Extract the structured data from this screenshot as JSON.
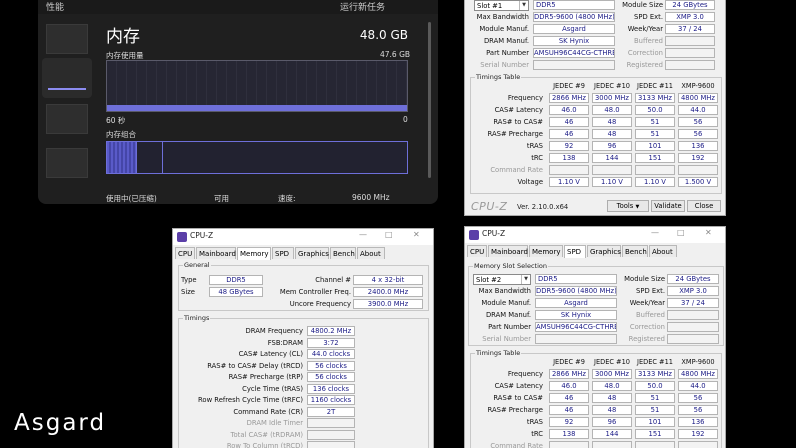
{
  "taskmgr": {
    "top_title": "性能",
    "top_right": "运行新任务",
    "title": "内存",
    "total": "48.0 GB",
    "usage_label": "内存使用量",
    "usage_max": "47.6 GB",
    "time_label": "60 秒",
    "zero_label": "0",
    "composition_label": "内存组合",
    "in_use_label": "使用中(已压缩)",
    "available_label": "可用",
    "speed_label": "速度:",
    "speed_value": "9600 MHz"
  },
  "cpuz_tr": {
    "slot": "Slot #1",
    "type": "DDR5",
    "module_size": "24 GBytes",
    "max_bandwidth": "DDR5-9600 (4800 MHz)",
    "spd_ext": "XMP 3.0",
    "module_manuf": "Asgard",
    "week_year": "37 / 24",
    "dram_manuf": "SK Hynix",
    "part_number": "AMSUH96C44CG-CTHRBM",
    "labels": {
      "max_bandwidth": "Max Bandwidth",
      "module_manuf": "Module Manuf.",
      "dram_manuf": "DRAM Manuf.",
      "part_number": "Part Number",
      "serial_number": "Serial Number",
      "module_size": "Module Size",
      "spd_ext": "SPD Ext.",
      "week_year": "Week/Year",
      "buffered": "Buffered",
      "correction": "Correction",
      "registered": "Registered"
    },
    "timings_title": "Timings Table",
    "columns": [
      "JEDEC #9",
      "JEDEC #10",
      "JEDEC #11",
      "XMP-9600"
    ],
    "rows": [
      {
        "label": "Frequency",
        "values": [
          "2866 MHz",
          "3000 MHz",
          "3133 MHz",
          "4800 MHz"
        ]
      },
      {
        "label": "CAS# Latency",
        "values": [
          "46.0",
          "48.0",
          "50.0",
          "44.0"
        ]
      },
      {
        "label": "RAS# to CAS#",
        "values": [
          "46",
          "48",
          "51",
          "56"
        ]
      },
      {
        "label": "RAS# Precharge",
        "values": [
          "46",
          "48",
          "51",
          "56"
        ]
      },
      {
        "label": "tRAS",
        "values": [
          "92",
          "96",
          "101",
          "136"
        ]
      },
      {
        "label": "tRC",
        "values": [
          "138",
          "144",
          "151",
          "192"
        ]
      },
      {
        "label": "Command Rate",
        "values": [
          "",
          "",
          "",
          ""
        ]
      },
      {
        "label": "Voltage",
        "values": [
          "1.10 V",
          "1.10 V",
          "1.10 V",
          "1.500 V"
        ]
      }
    ],
    "logo": "CPU-Z",
    "version": "Ver. 2.10.0.x64",
    "tools": "Tools",
    "validate": "Validate",
    "close": "Close"
  },
  "cpuz_mem": {
    "title": "CPU-Z",
    "tabs": [
      "CPU",
      "Mainboard",
      "Memory",
      "SPD",
      "Graphics",
      "Bench",
      "About"
    ],
    "general_title": "General",
    "type_label": "Type",
    "type": "DDR5",
    "size_label": "Size",
    "size": "48 GBytes",
    "channel_label": "Channel #",
    "channel": "4 x 32-bit",
    "mem_ctrl_label": "Mem Controller Freq.",
    "mem_ctrl": "2400.0 MHz",
    "uncore_label": "Uncore Frequency",
    "uncore": "3900.0 MHz",
    "timings_title": "Timings",
    "rows": [
      {
        "label": "DRAM Frequency",
        "value": "4800.2 MHz"
      },
      {
        "label": "FSB:DRAM",
        "value": "3:72"
      },
      {
        "label": "CAS# Latency (CL)",
        "value": "44.0 clocks"
      },
      {
        "label": "RAS# to CAS# Delay (tRCD)",
        "value": "56 clocks"
      },
      {
        "label": "RAS# Precharge (tRP)",
        "value": "56 clocks"
      },
      {
        "label": "Cycle Time (tRAS)",
        "value": "136 clocks"
      },
      {
        "label": "Row Refresh Cycle Time (tRFC)",
        "value": "1160 clocks"
      },
      {
        "label": "Command Rate (CR)",
        "value": "2T"
      },
      {
        "label": "DRAM Idle Timer",
        "value": ""
      },
      {
        "label": "Total CAS# (tRDRAM)",
        "value": ""
      },
      {
        "label": "Row To Column (tRCD)",
        "value": ""
      }
    ]
  },
  "cpuz_spd": {
    "title": "CPU-Z",
    "tabs": [
      "CPU",
      "Mainboard",
      "Memory",
      "SPD",
      "Graphics",
      "Bench",
      "About"
    ],
    "slot_section": "Memory Slot Selection",
    "slot": "Slot #2",
    "type": "DDR5",
    "module_size": "24 GBytes",
    "max_bandwidth": "DDR5-9600 (4800 MHz)",
    "spd_ext": "XMP 3.0",
    "module_manuf": "Asgard",
    "week_year": "37 / 24",
    "dram_manuf": "SK Hynix",
    "part_number": "AMSUH96C44CG-CTHRBM",
    "timings_title": "Timings Table",
    "columns": [
      "JEDEC #9",
      "JEDEC #10",
      "JEDEC #11",
      "XMP-9600"
    ],
    "rows": [
      {
        "label": "Frequency",
        "values": [
          "2866 MHz",
          "3000 MHz",
          "3133 MHz",
          "4800 MHz"
        ]
      },
      {
        "label": "CAS# Latency",
        "values": [
          "46.0",
          "48.0",
          "50.0",
          "44.0"
        ]
      },
      {
        "label": "RAS# to CAS#",
        "values": [
          "46",
          "48",
          "51",
          "56"
        ]
      },
      {
        "label": "RAS# Precharge",
        "values": [
          "46",
          "48",
          "51",
          "56"
        ]
      },
      {
        "label": "tRAS",
        "values": [
          "92",
          "96",
          "101",
          "136"
        ]
      },
      {
        "label": "tRC",
        "values": [
          "138",
          "144",
          "151",
          "192"
        ]
      },
      {
        "label": "Command Rate",
        "values": [
          "",
          "",
          "",
          ""
        ]
      }
    ]
  },
  "brand": "Asgard"
}
